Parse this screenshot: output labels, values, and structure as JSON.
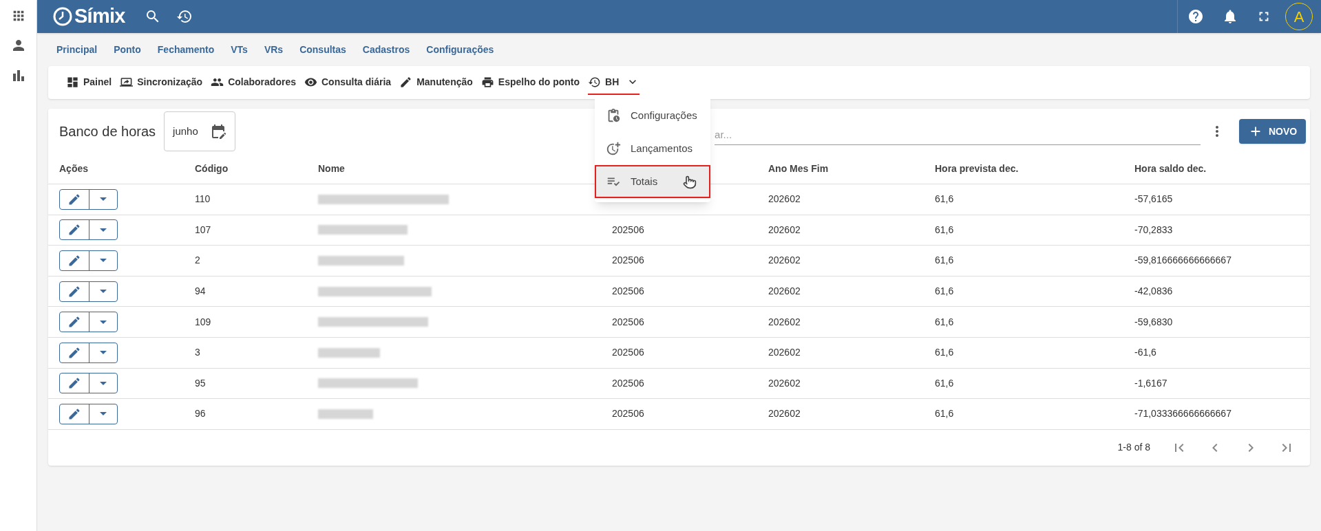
{
  "app": {
    "logo_text": "Símix",
    "avatar_letter": "A"
  },
  "nav": [
    "Principal",
    "Ponto",
    "Fechamento",
    "VTs",
    "VRs",
    "Consultas",
    "Cadastros",
    "Configurações"
  ],
  "toolbar": [
    {
      "label": "Painel",
      "selected": false
    },
    {
      "label": "Sincronização",
      "selected": false
    },
    {
      "label": "Colaboradores",
      "selected": false
    },
    {
      "label": "Consulta diária",
      "selected": false
    },
    {
      "label": "Manutenção",
      "selected": false
    },
    {
      "label": "Espelho do ponto",
      "selected": false
    },
    {
      "label": "BH",
      "selected": true
    }
  ],
  "menu": [
    {
      "label": "Configurações",
      "highlighted": false
    },
    {
      "label": "Lançamentos",
      "highlighted": false
    },
    {
      "label": "Totais",
      "highlighted": true
    }
  ],
  "panel": {
    "title": "Banco de horas",
    "month": "junho",
    "search_placeholder": "ar...",
    "new_button": "NOVO"
  },
  "table": {
    "columns": [
      "Ações",
      "Código",
      "Nome",
      null,
      "Ano Mes Fim",
      "Hora prevista dec.",
      "Hora saldo dec."
    ],
    "rows": [
      {
        "code": "110",
        "name_redacted": true,
        "start": null,
        "end": "202602",
        "expected": "61,6",
        "balance": "-57,6165"
      },
      {
        "code": "107",
        "name_redacted": true,
        "start": "202506",
        "end": "202602",
        "expected": "61,6",
        "balance": "-70,2833"
      },
      {
        "code": "2",
        "name_redacted": true,
        "start": "202506",
        "end": "202602",
        "expected": "61,6",
        "balance": "-59,816666666666667"
      },
      {
        "code": "94",
        "name_redacted": true,
        "start": "202506",
        "end": "202602",
        "expected": "61,6",
        "balance": "-42,0836"
      },
      {
        "code": "109",
        "name_redacted": true,
        "start": "202506",
        "end": "202602",
        "expected": "61,6",
        "balance": "-59,6830"
      },
      {
        "code": "3",
        "name_redacted": true,
        "start": "202506",
        "end": "202602",
        "expected": "61,6",
        "balance": "-61,6"
      },
      {
        "code": "95",
        "name_redacted": true,
        "start": "202506",
        "end": "202602",
        "expected": "61,6",
        "balance": "-1,6167"
      },
      {
        "code": "96",
        "name_redacted": true,
        "start": "202506",
        "end": "202602",
        "expected": "61,6",
        "balance": "-71,033366666666667"
      }
    ]
  },
  "pagination": {
    "range": "1-8 of 8"
  }
}
